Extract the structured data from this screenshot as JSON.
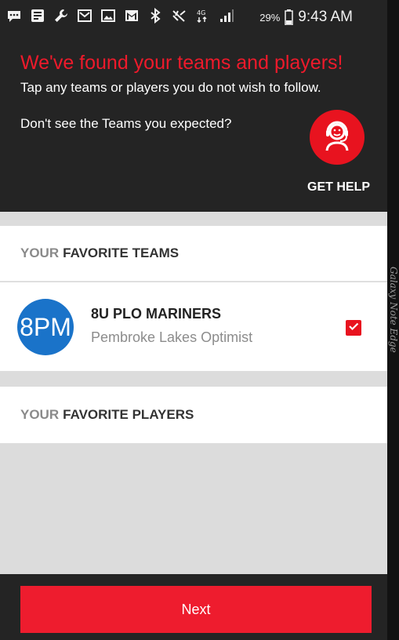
{
  "status_bar": {
    "battery_percent": "29%",
    "time": "9:43 AM",
    "icons": [
      "messenger-icon",
      "news-app-icon",
      "wrench-icon",
      "email-icon",
      "gallery-icon",
      "gmail-icon",
      "bluetooth-icon",
      "mute-icon",
      "lte-icon",
      "signal-icon",
      "battery-icon"
    ]
  },
  "header": {
    "title": "We've found your teams and players!",
    "subtitle": "Tap any teams or players you do not wish to follow.",
    "help_prompt": "Don't see the Teams you expected?",
    "help_label": "GET HELP",
    "help_icon": "support-agent-icon"
  },
  "teams_section": {
    "prefix": "YOUR",
    "title": "FAVORITE TEAMS",
    "teams": [
      {
        "logo_text": "8PM",
        "name": "8U PLO MARINERS",
        "org": "Pembroke Lakes Optimist",
        "checked": true
      }
    ]
  },
  "players_section": {
    "prefix": "YOUR",
    "title": "FAVORITE PLAYERS"
  },
  "footer": {
    "next_label": "Next"
  },
  "device_label": "Galaxy Note Edge",
  "colors": {
    "accent_red": "#ee1c2e",
    "header_bg": "#242424",
    "content_bg": "#dcdcdc",
    "team_logo_blue": "#1a73c9"
  }
}
